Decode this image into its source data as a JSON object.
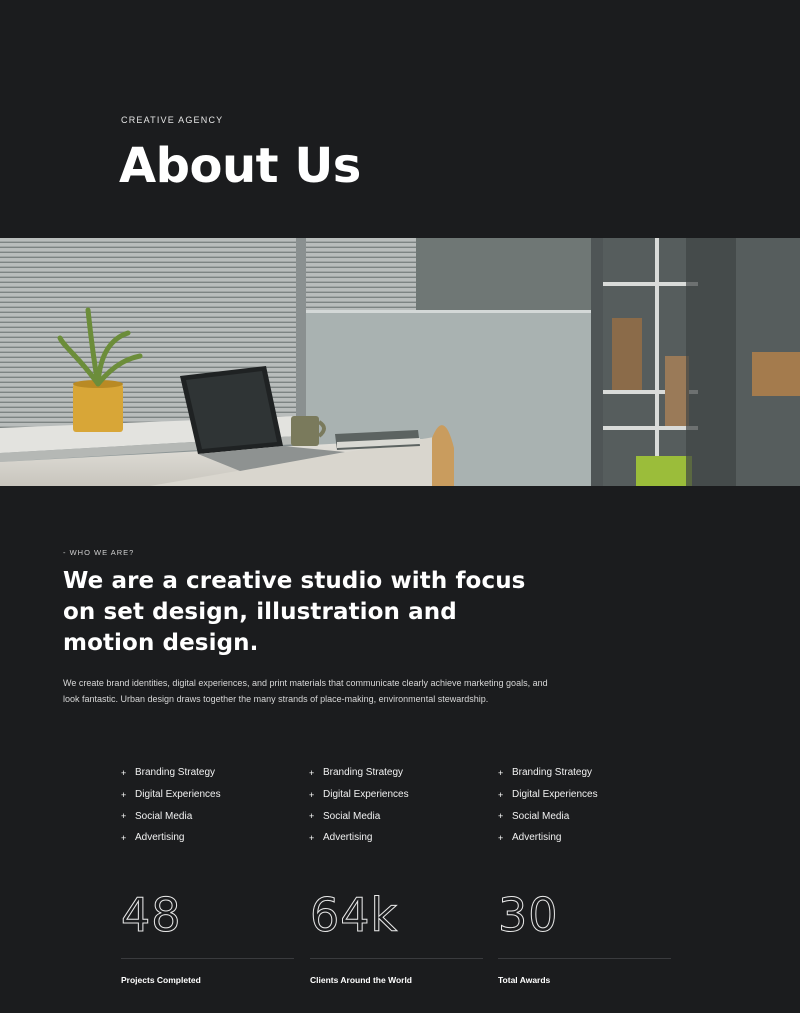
{
  "hero": {
    "eyebrow": "CREATIVE AGENCY",
    "title": "About Us"
  },
  "about": {
    "eyebrow": "- WHO WE ARE?",
    "heading": "We are a creative studio with focus on set design, illustration and motion design.",
    "body": "We create brand identities, digital experiences, and print materials that communicate clearly achieve marketing goals, and look fantastic. Urban design draws together the many strands of place-making, environmental stewardship."
  },
  "services": {
    "columns": [
      [
        "Branding Strategy",
        "Digital Experiences",
        "Social Media",
        "Advertising"
      ],
      [
        "Branding Strategy",
        "Digital Experiences",
        "Social Media",
        "Advertising"
      ],
      [
        "Branding Strategy",
        "Digital Experiences",
        "Social Media",
        "Advertising"
      ]
    ],
    "bullet": "+"
  },
  "stats": [
    {
      "value": "48",
      "label": "Projects Completed"
    },
    {
      "value": "64k",
      "label": "Clients Around the World"
    },
    {
      "value": "30",
      "label": "Total Awards"
    }
  ],
  "colors": {
    "background": "#1b1c1e",
    "text": "#ffffff",
    "muted_text": "#d8d8d8",
    "divider": "#3a3b3e"
  }
}
